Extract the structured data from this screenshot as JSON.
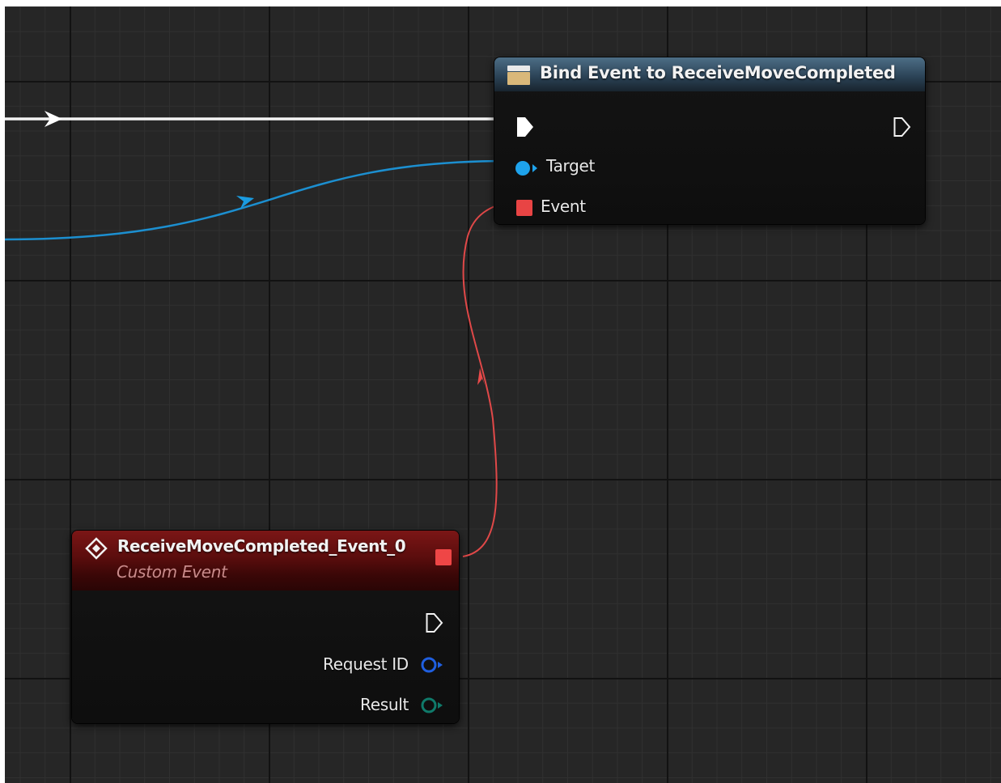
{
  "bind_node": {
    "title": "Bind Event to ReceiveMoveCompleted",
    "icon": "delegate-icon",
    "header_color": "#3d5a70",
    "pins": {
      "exec_in": "exec-in-pin",
      "exec_out": "exec-out-pin",
      "target_label": "Target",
      "event_label": "Event"
    }
  },
  "event_node": {
    "title": "ReceiveMoveCompleted_Event_0",
    "subtitle": "Custom Event",
    "icon": "custom-event-diamond-icon",
    "header_color": "#6a1010",
    "pins": {
      "request_id_label": "Request ID",
      "result_label": "Result"
    }
  },
  "colors": {
    "graph_background": "#262626",
    "exec_wire": "#ffffff",
    "object_wire": "#1aa0e6",
    "delegate_wire": "#e04545",
    "int_pin": "#1f5fe0",
    "enum_pin": "#0f7a6a"
  }
}
